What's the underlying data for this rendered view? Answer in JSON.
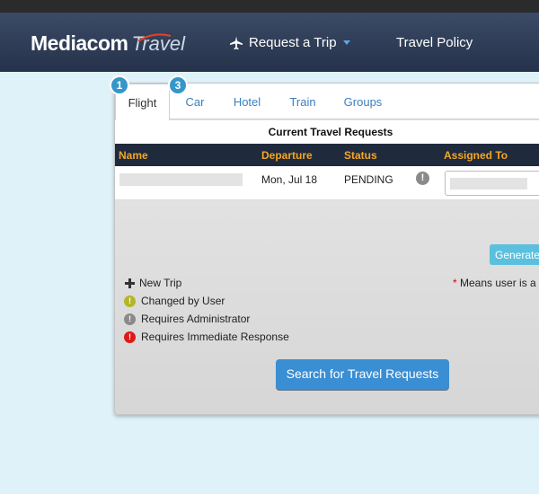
{
  "app": {
    "logo_main": "Mediacom",
    "logo_sub": "Travel"
  },
  "nav": {
    "request_trip": "Request a Trip",
    "travel_policy": "Travel Policy"
  },
  "tabs": [
    {
      "label": "Flight",
      "active": true,
      "badge": "1"
    },
    {
      "label": "Car",
      "active": false,
      "badge": "3"
    },
    {
      "label": "Hotel",
      "active": false
    },
    {
      "label": "Train",
      "active": false
    },
    {
      "label": "Groups",
      "active": false
    }
  ],
  "table": {
    "title": "Current Travel Requests",
    "columns": [
      "Name",
      "Departure",
      "Status",
      "Assigned To"
    ],
    "rows": [
      {
        "name": "",
        "departure": "Mon, Jul 18",
        "status": "PENDING",
        "assigned_to": ""
      }
    ]
  },
  "actions": {
    "generate": "Generate",
    "search": "Search for Travel Requests"
  },
  "note": {
    "star": "*",
    "text": "Means user is a"
  },
  "legend": [
    {
      "label": "New Trip",
      "icon": "plus-icon"
    },
    {
      "label": "Changed by User",
      "icon": "alert-icon",
      "color": "#b5b52a"
    },
    {
      "label": "Requires Administrator",
      "icon": "alert-icon",
      "color": "#8a8a8a"
    },
    {
      "label": "Requires Immediate Response",
      "icon": "alert-icon",
      "color": "#e01818"
    }
  ],
  "colors": {
    "navbar": "#25324a",
    "accent_blue": "#3a8ed3",
    "header_orange": "#f5a623",
    "badge_blue": "#3597c9"
  }
}
